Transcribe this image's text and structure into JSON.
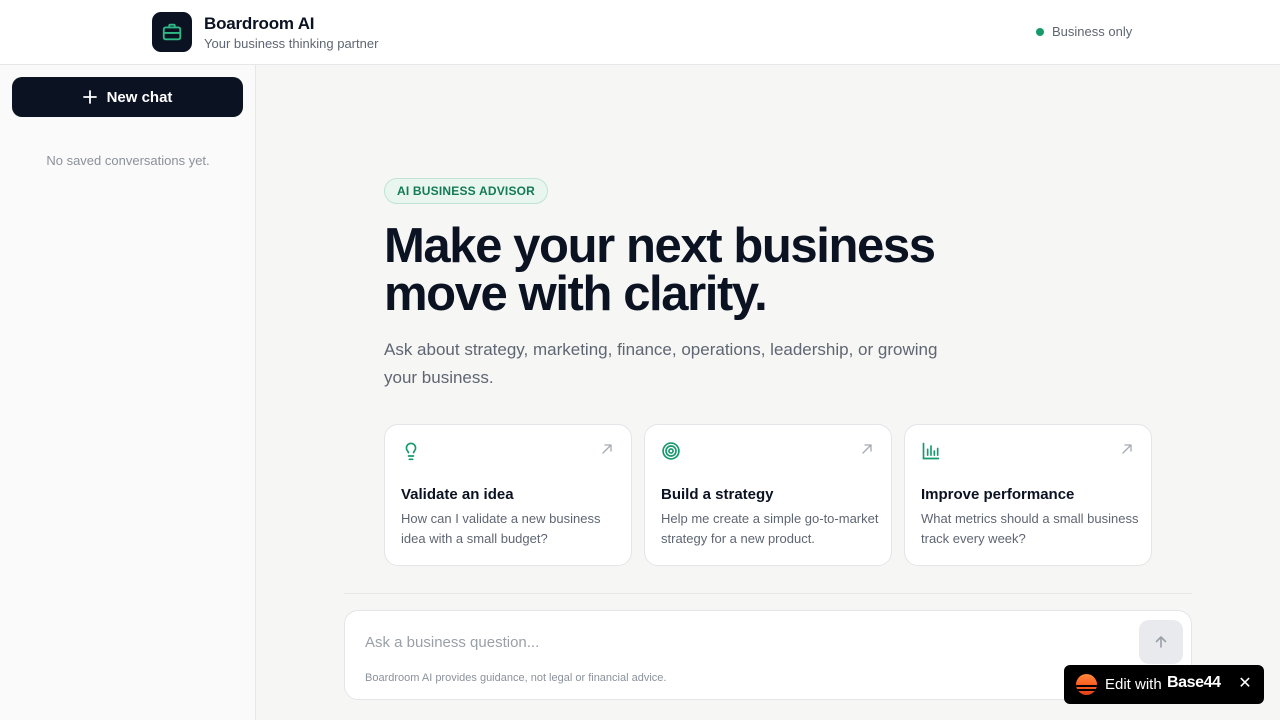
{
  "header": {
    "app_name": "Boardroom AI",
    "tagline": "Your business thinking partner",
    "status_label": "Business only",
    "logo_icon": "briefcase-icon",
    "status_color": "#169a6c"
  },
  "sidebar": {
    "new_chat_label": "New chat",
    "empty_text": "No saved conversations yet."
  },
  "main": {
    "badge": "AI BUSINESS ADVISOR",
    "headline_line1": "Make your next business",
    "headline_line2": "move with clarity.",
    "subtitle": "Ask about strategy, marketing, finance, operations, leadership, or growing your business.",
    "cards": [
      {
        "icon": "lightbulb-icon",
        "title": "Validate an idea",
        "description": "How can I validate a new business idea with a small budget?"
      },
      {
        "icon": "target-icon",
        "title": "Build a strategy",
        "description": "Help me create a simple go-to-market strategy for a new product."
      },
      {
        "icon": "bar-chart-icon",
        "title": "Improve performance",
        "description": "What metrics should a small business track every week?"
      }
    ]
  },
  "composer": {
    "placeholder": "Ask a business question...",
    "value": "",
    "disclaimer": "Boardroom AI provides guidance, not legal or financial advice."
  },
  "badge44": {
    "prefix": "Edit with",
    "brand": "Base44"
  },
  "colors": {
    "accent": "#169a6c",
    "primary": "#0b1222",
    "background": "#f6f6f4"
  }
}
